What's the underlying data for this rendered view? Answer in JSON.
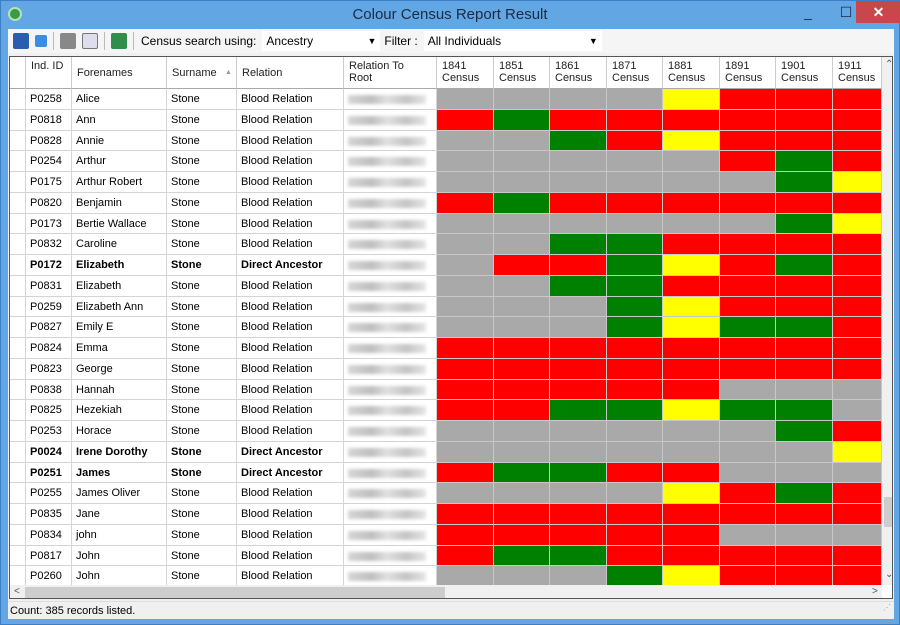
{
  "window": {
    "title": "Colour Census Report Result",
    "minimize": "_",
    "maximize": "☐",
    "close": "✕"
  },
  "toolbar": {
    "icons": [
      "save-icon",
      "save-as-icon",
      "print-icon",
      "print-preview-icon",
      "export-excel-icon"
    ],
    "census_search_label": "Census search using:",
    "census_search_value": "Ancestry",
    "filter_label": "Filter :",
    "filter_value": "All Individuals"
  },
  "status_colors": {
    "G": "#a9a9a9",
    "R": "#ff0000",
    "N": "#008000",
    "Y": "#ffff00"
  },
  "grid": {
    "columns": [
      "Ind. ID",
      "Forenames",
      "Surname",
      "Relation",
      "Relation To Root",
      "1841 Census",
      "1851 Census",
      "1861 Census",
      "1871 Census",
      "1881 Census",
      "1891 Census",
      "1901 Census",
      "1911 Census"
    ],
    "sort_column": "Surname",
    "sort_direction": "ascending",
    "rows": [
      {
        "id": "P0258",
        "forenames": "Alice",
        "surname": "Stone",
        "relation": "Blood Relation",
        "bold": false,
        "census": "GGGGYRRR"
      },
      {
        "id": "P0818",
        "forenames": "Ann",
        "surname": "Stone",
        "relation": "Blood Relation",
        "bold": false,
        "census": "RNRRRRRR"
      },
      {
        "id": "P0828",
        "forenames": "Annie",
        "surname": "Stone",
        "relation": "Blood Relation",
        "bold": false,
        "census": "GGNRYRRR"
      },
      {
        "id": "P0254",
        "forenames": "Arthur",
        "surname": "Stone",
        "relation": "Blood Relation",
        "bold": false,
        "census": "GGGGGRNR"
      },
      {
        "id": "P0175",
        "forenames": "Arthur Robert",
        "surname": "Stone",
        "relation": "Blood Relation",
        "bold": false,
        "census": "GGGGGGNY"
      },
      {
        "id": "P0820",
        "forenames": "Benjamin",
        "surname": "Stone",
        "relation": "Blood Relation",
        "bold": false,
        "census": "RNRRRRRR"
      },
      {
        "id": "P0173",
        "forenames": "Bertie Wallace",
        "surname": "Stone",
        "relation": "Blood Relation",
        "bold": false,
        "census": "GGGGGGNY"
      },
      {
        "id": "P0832",
        "forenames": "Caroline",
        "surname": "Stone",
        "relation": "Blood Relation",
        "bold": false,
        "census": "GGNNRRRR"
      },
      {
        "id": "P0172",
        "forenames": "Elizabeth",
        "surname": "Stone",
        "relation": "Direct Ancestor",
        "bold": true,
        "census": "GRRNYRNR"
      },
      {
        "id": "P0831",
        "forenames": "Elizabeth",
        "surname": "Stone",
        "relation": "Blood Relation",
        "bold": false,
        "census": "GGNNRRRR"
      },
      {
        "id": "P0259",
        "forenames": "Elizabeth Ann",
        "surname": "Stone",
        "relation": "Blood Relation",
        "bold": false,
        "census": "GGGNYRRR"
      },
      {
        "id": "P0827",
        "forenames": "Emily E",
        "surname": "Stone",
        "relation": "Blood Relation",
        "bold": false,
        "census": "GGGNYNNR"
      },
      {
        "id": "P0824",
        "forenames": "Emma",
        "surname": "Stone",
        "relation": "Blood Relation",
        "bold": false,
        "census": "RRRRRRRR"
      },
      {
        "id": "P0823",
        "forenames": "George",
        "surname": "Stone",
        "relation": "Blood Relation",
        "bold": false,
        "census": "RRRRRRRR"
      },
      {
        "id": "P0838",
        "forenames": "Hannah",
        "surname": "Stone",
        "relation": "Blood Relation",
        "bold": false,
        "census": "RRRRRGGG"
      },
      {
        "id": "P0825",
        "forenames": "Hezekiah",
        "surname": "Stone",
        "relation": "Blood Relation",
        "bold": false,
        "census": "RRNNYNNG"
      },
      {
        "id": "P0253",
        "forenames": "Horace",
        "surname": "Stone",
        "relation": "Blood Relation",
        "bold": false,
        "census": "GGGGGGNR"
      },
      {
        "id": "P0024",
        "forenames": "Irene Dorothy",
        "surname": "Stone",
        "relation": "Direct Ancestor",
        "bold": true,
        "census": "GGGGGGGY"
      },
      {
        "id": "P0251",
        "forenames": "James",
        "surname": "Stone",
        "relation": "Direct Ancestor",
        "bold": true,
        "census": "RNNRRGGG"
      },
      {
        "id": "P0255",
        "forenames": "James Oliver",
        "surname": "Stone",
        "relation": "Blood Relation",
        "bold": false,
        "census": "GGGGYRNR"
      },
      {
        "id": "P0835",
        "forenames": "Jane",
        "surname": "Stone",
        "relation": "Blood Relation",
        "bold": false,
        "census": "RRRRRRRR"
      },
      {
        "id": "P0834",
        "forenames": "john",
        "surname": "Stone",
        "relation": "Blood Relation",
        "bold": false,
        "census": "RRRRRGGG"
      },
      {
        "id": "P0817",
        "forenames": "John",
        "surname": "Stone",
        "relation": "Blood Relation",
        "bold": false,
        "census": "RNNRRRRR"
      },
      {
        "id": "P0260",
        "forenames": "John",
        "surname": "Stone",
        "relation": "Blood Relation",
        "bold": false,
        "census": "GGGNYRRR"
      }
    ]
  },
  "status_bar": {
    "text": "Count: 385 records listed."
  }
}
